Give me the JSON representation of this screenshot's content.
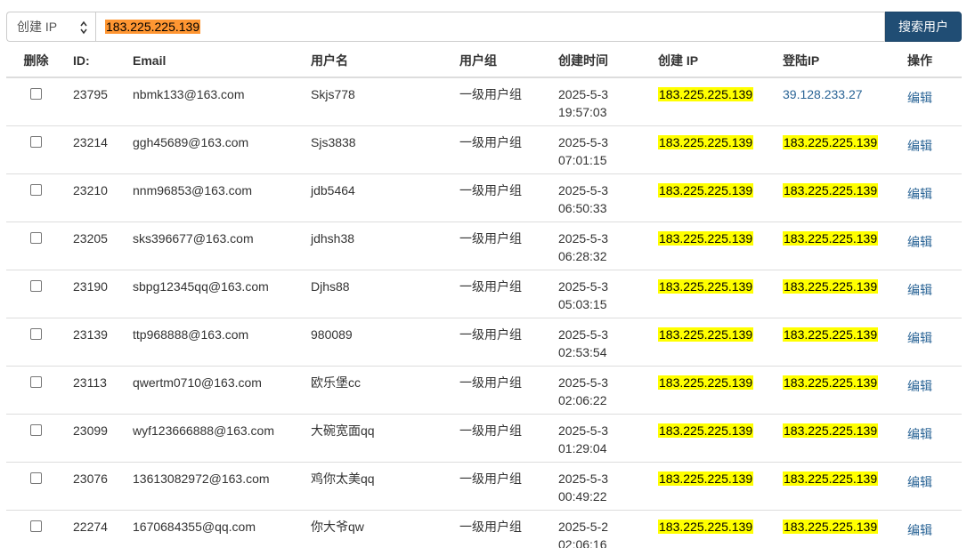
{
  "search": {
    "select_value": "创建 IP",
    "input_value": "183.225.225.139",
    "button_label": "搜索用户"
  },
  "table": {
    "headers": {
      "del": "删除",
      "id": "ID:",
      "email": "Email",
      "username": "用户名",
      "group": "用户组",
      "created_time": "创建时间",
      "created_ip": "创建 IP",
      "login_ip": "登陆IP",
      "action": "操作"
    },
    "rows": [
      {
        "id": "23795",
        "email": "nbmk133@163.com",
        "username": "Skjs778",
        "group": "一级用户组",
        "date": "2025-5-3",
        "time": "19:57:03",
        "created_ip": "183.225.225.139",
        "login_ip": "39.128.233.27",
        "action": "编辑"
      },
      {
        "id": "23214",
        "email": "ggh45689@163.com",
        "username": "Sjs3838",
        "group": "一级用户组",
        "date": "2025-5-3",
        "time": "07:01:15",
        "created_ip": "183.225.225.139",
        "login_ip": "183.225.225.139",
        "action": "编辑"
      },
      {
        "id": "23210",
        "email": "nnm96853@163.com",
        "username": "jdb5464",
        "group": "一级用户组",
        "date": "2025-5-3",
        "time": "06:50:33",
        "created_ip": "183.225.225.139",
        "login_ip": "183.225.225.139",
        "action": "编辑"
      },
      {
        "id": "23205",
        "email": "sks396677@163.com",
        "username": "jdhsh38",
        "group": "一级用户组",
        "date": "2025-5-3",
        "time": "06:28:32",
        "created_ip": "183.225.225.139",
        "login_ip": "183.225.225.139",
        "action": "编辑"
      },
      {
        "id": "23190",
        "email": "sbpg12345qq@163.com",
        "username": "Djhs88",
        "group": "一级用户组",
        "date": "2025-5-3",
        "time": "05:03:15",
        "created_ip": "183.225.225.139",
        "login_ip": "183.225.225.139",
        "action": "编辑"
      },
      {
        "id": "23139",
        "email": "ttp968888@163.com",
        "username": "980089",
        "group": "一级用户组",
        "date": "2025-5-3",
        "time": "02:53:54",
        "created_ip": "183.225.225.139",
        "login_ip": "183.225.225.139",
        "action": "编辑"
      },
      {
        "id": "23113",
        "email": "qwertm0710@163.com",
        "username": "欧乐堡cc",
        "group": "一级用户组",
        "date": "2025-5-3",
        "time": "02:06:22",
        "created_ip": "183.225.225.139",
        "login_ip": "183.225.225.139",
        "action": "编辑"
      },
      {
        "id": "23099",
        "email": "wyf123666888@163.com",
        "username": "大碗宽面qq",
        "group": "一级用户组",
        "date": "2025-5-3",
        "time": "01:29:04",
        "created_ip": "183.225.225.139",
        "login_ip": "183.225.225.139",
        "action": "编辑"
      },
      {
        "id": "23076",
        "email": "13613082972@163.com",
        "username": "鸡你太美qq",
        "group": "一级用户组",
        "date": "2025-5-3",
        "time": "00:49:22",
        "created_ip": "183.225.225.139",
        "login_ip": "183.225.225.139",
        "action": "编辑"
      },
      {
        "id": "22274",
        "email": "1670684355@qq.com",
        "username": "你大爷qw",
        "group": "一级用户组",
        "date": "2025-5-2",
        "time": "02:06:16",
        "created_ip": "183.225.225.139",
        "login_ip": "183.225.225.139",
        "action": "编辑"
      }
    ]
  },
  "colors": {
    "button_bg": "#204d74",
    "highlight": "#ffff00",
    "search_highlight": "#ff9632",
    "link": "#2a6496"
  }
}
